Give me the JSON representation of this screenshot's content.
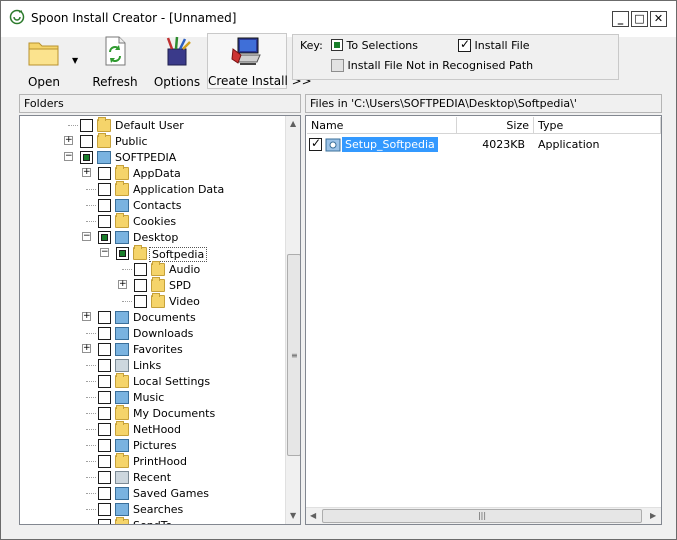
{
  "window": {
    "title": "Spoon Install Creator - [Unnamed]",
    "controls": {
      "minimize": "_",
      "maximize": "□",
      "close": "✕"
    }
  },
  "toolbar": {
    "open_label": "Open",
    "refresh_label": "Refresh",
    "options_label": "Options",
    "create_install_label": "Create Install >>"
  },
  "key": {
    "label": "Key:",
    "to_selections": "To Selections",
    "install_file": "Install File",
    "not_recognised": "Install File Not in Recognised Path"
  },
  "folders_pane": {
    "header": "Folders",
    "items": [
      {
        "label": "Default User",
        "icon": "folder-icon",
        "expander": "",
        "checkbox": "empty"
      },
      {
        "label": "Public",
        "icon": "folder-icon",
        "expander": "+",
        "checkbox": "empty"
      },
      {
        "label": "SOFTPEDIA",
        "icon": "user-folder-icon",
        "expander": "−",
        "checkbox": "partial"
      },
      {
        "label": "AppData",
        "icon": "folder-icon",
        "expander": "+",
        "checkbox": "empty"
      },
      {
        "label": "Application Data",
        "icon": "folder-icon",
        "expander": "",
        "checkbox": "empty"
      },
      {
        "label": "Contacts",
        "icon": "contacts-icon",
        "expander": "",
        "checkbox": "empty"
      },
      {
        "label": "Cookies",
        "icon": "folder-icon",
        "expander": "",
        "checkbox": "empty"
      },
      {
        "label": "Desktop",
        "icon": "desktop-icon",
        "expander": "−",
        "checkbox": "partial"
      },
      {
        "label": "Softpedia",
        "icon": "folder-icon",
        "expander": "−",
        "checkbox": "partial"
      },
      {
        "label": "Audio",
        "icon": "folder-icon",
        "expander": "",
        "checkbox": "empty"
      },
      {
        "label": "SPD",
        "icon": "folder-icon",
        "expander": "+",
        "checkbox": "empty"
      },
      {
        "label": "Video",
        "icon": "folder-icon",
        "expander": "",
        "checkbox": "empty"
      },
      {
        "label": "Documents",
        "icon": "documents-icon",
        "expander": "+",
        "checkbox": "empty"
      },
      {
        "label": "Downloads",
        "icon": "downloads-icon",
        "expander": "",
        "checkbox": "empty"
      },
      {
        "label": "Favorites",
        "icon": "favorites-icon",
        "expander": "+",
        "checkbox": "empty"
      },
      {
        "label": "Links",
        "icon": "links-icon",
        "expander": "",
        "checkbox": "empty"
      },
      {
        "label": "Local Settings",
        "icon": "folder-icon",
        "expander": "",
        "checkbox": "empty"
      },
      {
        "label": "Music",
        "icon": "music-icon",
        "expander": "",
        "checkbox": "empty"
      },
      {
        "label": "My Documents",
        "icon": "folder-icon",
        "expander": "",
        "checkbox": "empty"
      },
      {
        "label": "NetHood",
        "icon": "folder-icon",
        "expander": "",
        "checkbox": "empty"
      },
      {
        "label": "Pictures",
        "icon": "pictures-icon",
        "expander": "",
        "checkbox": "empty"
      },
      {
        "label": "PrintHood",
        "icon": "folder-icon",
        "expander": "",
        "checkbox": "empty"
      },
      {
        "label": "Recent",
        "icon": "recent-icon",
        "expander": "",
        "checkbox": "empty"
      },
      {
        "label": "Saved Games",
        "icon": "saved-games-icon",
        "expander": "",
        "checkbox": "empty"
      },
      {
        "label": "Searches",
        "icon": "searches-icon",
        "expander": "",
        "checkbox": "empty"
      },
      {
        "label": "SendTo",
        "icon": "folder-icon",
        "expander": "",
        "checkbox": "empty"
      }
    ]
  },
  "files_pane": {
    "header": "Files in 'C:\\Users\\SOFTPEDIA\\Desktop\\Softpedia\\'",
    "columns": {
      "name": "Name",
      "size": "Size",
      "type": "Type"
    },
    "files": [
      {
        "name": "Setup_Softpedia",
        "size": "4023KB",
        "type": "Application",
        "checked": true
      }
    ]
  }
}
